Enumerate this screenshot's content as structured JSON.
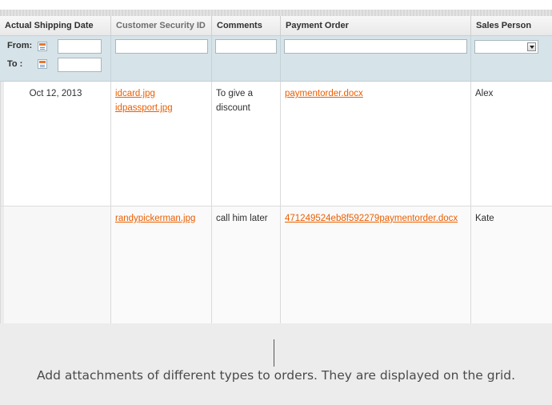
{
  "columns": [
    {
      "label": "Actual Shipping Date",
      "sortable": false
    },
    {
      "label": "Customer Security ID",
      "sortable": true
    },
    {
      "label": "Comments",
      "sortable": false
    },
    {
      "label": "Payment Order",
      "sortable": false
    },
    {
      "label": "Sales Person",
      "sortable": false
    }
  ],
  "filters": {
    "from_label": "From:",
    "to_label": "To :",
    "from_value": "",
    "to_value": "",
    "customer_security_id": "",
    "comments": "",
    "payment_order": "",
    "sales_person_selected": ""
  },
  "rows": [
    {
      "actual_shipping_date": "Oct 12, 2013",
      "customer_security_id": [
        "idcard.jpg",
        "idpassport.jpg"
      ],
      "comments": "To give a discount",
      "payment_order": [
        "paymentorder.docx"
      ],
      "sales_person": "Alex"
    },
    {
      "actual_shipping_date": "",
      "customer_security_id": [
        "randypickerman.jpg"
      ],
      "comments": "call him later",
      "payment_order": [
        "471249524eb8f592279paymentorder.docx"
      ],
      "sales_person": "Kate"
    }
  ],
  "caption": "Add attachments of different types to orders. They are displayed on the grid.",
  "colors": {
    "link": "#eb5e00",
    "filter_bg": "#d6e3e8",
    "footer_bg": "#ececec"
  }
}
